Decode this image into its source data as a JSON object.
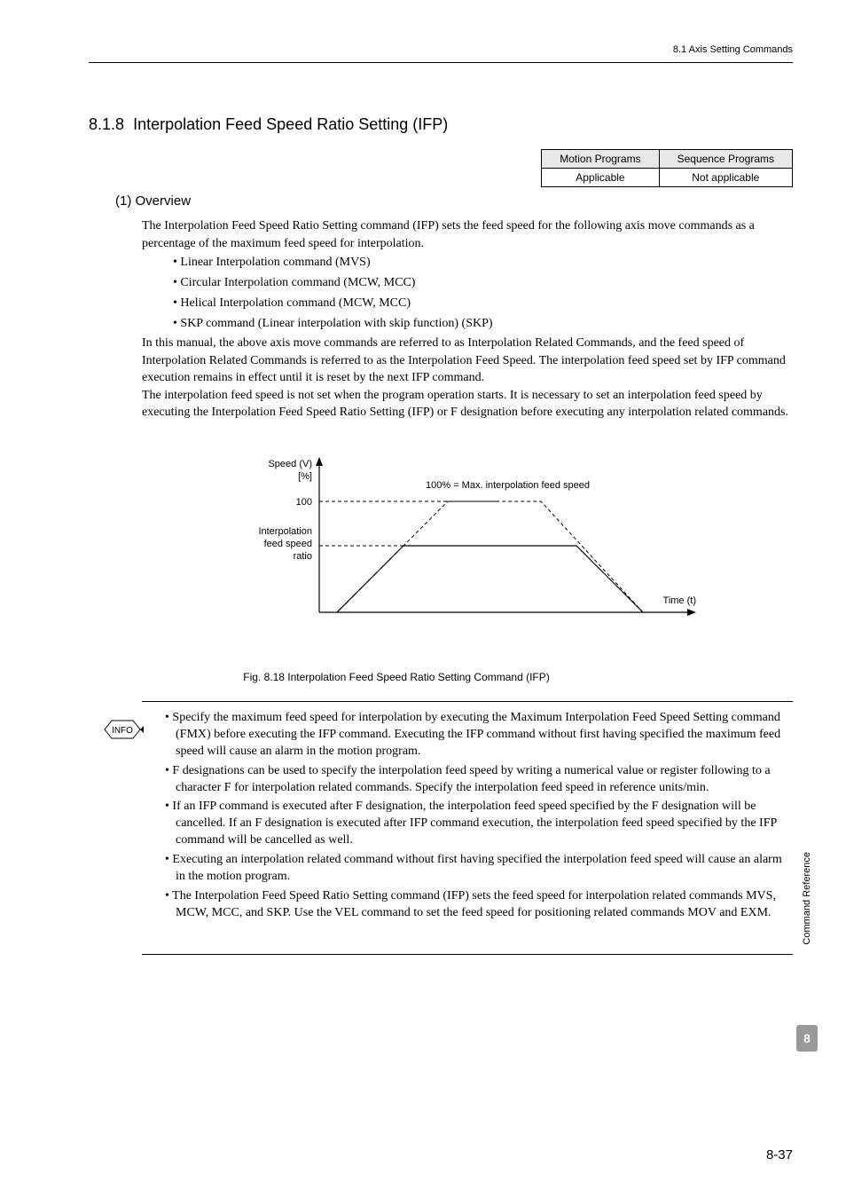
{
  "header": {
    "breadcrumb": "8.1  Axis Setting Commands"
  },
  "section": {
    "number": "8.1.8",
    "title": "Interpolation Feed Speed Ratio Setting (IFP)"
  },
  "applicability": {
    "col1_header": "Motion Programs",
    "col2_header": "Sequence Programs",
    "col1_value": "Applicable",
    "col2_value": "Not applicable"
  },
  "subsection": {
    "number": "(1)",
    "title": "Overview"
  },
  "overview": {
    "para1": "The Interpolation Feed Speed Ratio Setting command (IFP) sets the feed speed for the following axis move commands as a percentage of the maximum feed speed for interpolation.",
    "items": [
      "Linear Interpolation command (MVS)",
      "Circular Interpolation command (MCW, MCC)",
      "Helical Interpolation command (MCW, MCC)",
      "SKP command (Linear interpolation with skip function) (SKP)"
    ],
    "para2": "In this manual, the above axis move commands are referred to as Interpolation Related Commands, and the feed speed of Interpolation Related Commands is referred to as the Interpolation Feed Speed. The interpolation feed speed set by IFP command execution remains in effect until it is reset by the next IFP command.",
    "para3": "The interpolation feed speed is not set when the program operation starts. It is necessary to set an interpolation feed speed by executing the Interpolation Feed Speed Ratio Setting (IFP) or F designation before executing any interpolation related commands."
  },
  "diagram": {
    "y_label_1": "Speed (V)",
    "y_label_2": "[%]",
    "y_tick": "100",
    "y_label_3a": "Interpolation",
    "y_label_3b": "feed speed",
    "y_label_3c": "ratio",
    "annotation": "100% = Max. interpolation feed speed",
    "x_label": "Time (t)"
  },
  "caption": "Fig. 8.18  Interpolation Feed Speed Ratio Setting Command (IFP)",
  "info": {
    "badge": "INFO",
    "items": [
      "Specify the maximum feed speed for interpolation by executing the Maximum Interpolation Feed Speed Setting command (FMX) before executing the IFP command. Executing the IFP command without first having specified the maximum feed speed will cause an alarm in the motion program.",
      "F designations can be used to specify the interpolation feed speed by writing a numerical value or register following to a character F for interpolation related commands. Specify the interpolation feed speed in reference units/min.",
      "If an IFP command is executed after F designation, the interpolation feed speed specified by the F designation will be cancelled. If an F designation is executed after IFP command execution, the interpolation feed speed specified by the IFP command will be cancelled as well.",
      " Executing an interpolation related command without first having specified the interpolation feed speed will cause an alarm in the motion program.",
      "The Interpolation Feed Speed Ratio Setting command (IFP) sets the feed speed for interpolation related commands MVS, MCW, MCC, and SKP. Use the VEL command to set the feed speed for positioning related commands MOV and EXM."
    ]
  },
  "side": {
    "label": "Command Reference",
    "chapter": "8"
  },
  "footer": {
    "page": "8-37"
  }
}
